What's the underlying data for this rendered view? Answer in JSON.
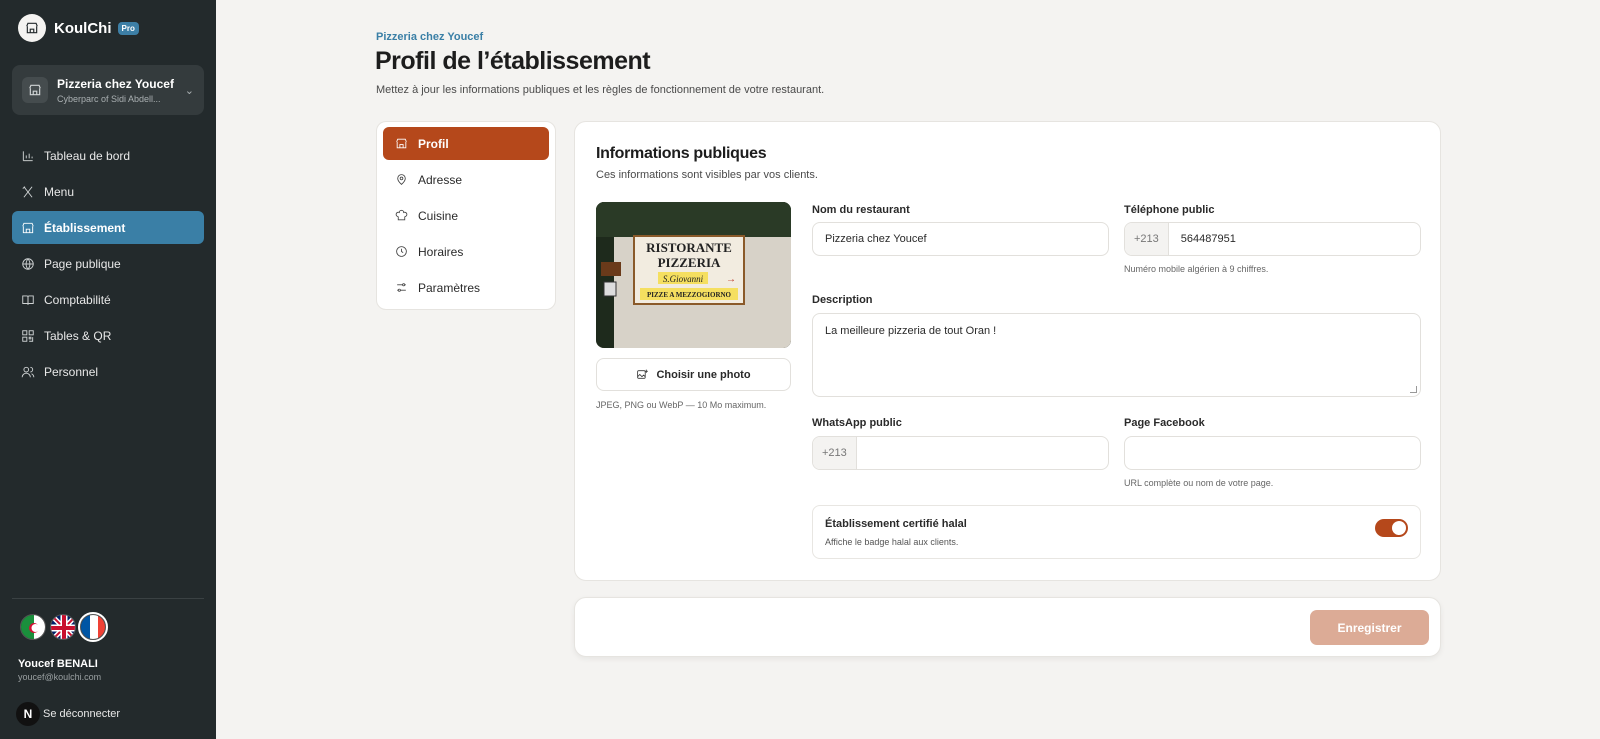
{
  "brand": {
    "name": "KoulChi",
    "badge": "Pro"
  },
  "establishment": {
    "name": "Pizzeria chez Youcef",
    "location": "Cyberparc of Sidi Abdell..."
  },
  "nav": [
    {
      "label": "Tableau de bord",
      "icon": "chart-icon"
    },
    {
      "label": "Menu",
      "icon": "utensils-icon"
    },
    {
      "label": "Établissement",
      "icon": "store-icon",
      "active": true
    },
    {
      "label": "Page publique",
      "icon": "globe-icon"
    },
    {
      "label": "Comptabilité",
      "icon": "book-icon"
    },
    {
      "label": "Tables & QR",
      "icon": "qr-icon"
    },
    {
      "label": "Personnel",
      "icon": "users-icon"
    }
  ],
  "languages": [
    "algeria-flag",
    "uk-flag",
    "france-flag"
  ],
  "user": {
    "name": "Youcef BENALI",
    "email": "youcef@koulchi.com",
    "logout_label": "Se déconnecter",
    "avatar_letter": "N"
  },
  "header": {
    "eyebrow": "Pizzeria chez Youcef",
    "title": "Profil de l’établissement",
    "subtitle": "Mettez à jour les informations publiques et les règles de fonctionnement de votre restaurant."
  },
  "subnav": [
    {
      "label": "Profil",
      "icon": "store-icon",
      "active": true
    },
    {
      "label": "Adresse",
      "icon": "pin-icon"
    },
    {
      "label": "Cuisine",
      "icon": "chef-hat-icon"
    },
    {
      "label": "Horaires",
      "icon": "clock-icon"
    },
    {
      "label": "Paramètres",
      "icon": "sliders-icon"
    }
  ],
  "form": {
    "title": "Informations publiques",
    "subtitle": "Ces informations sont visibles par vos clients.",
    "photo_button": "Choisir une photo",
    "photo_hint": "JPEG, PNG ou WebP — 10 Mo maximum.",
    "photo_sign": {
      "line1": "RISTORANTE",
      "line2": "PIZZERIA",
      "line3": "S.Giovanni",
      "line4": "PIZZE A MEZZOGIORNO"
    },
    "name_label": "Nom du restaurant",
    "name_value": "Pizzeria chez Youcef",
    "phone_label": "Téléphone public",
    "phone_prefix": "+213",
    "phone_value": "564487951",
    "phone_hint": "Numéro mobile algérien à 9 chiffres.",
    "description_label": "Description",
    "description_value": "La meilleure pizzeria de tout Oran !",
    "whatsapp_label": "WhatsApp public",
    "whatsapp_prefix": "+213",
    "whatsapp_value": "",
    "facebook_label": "Page Facebook",
    "facebook_value": "",
    "facebook_hint": "URL complète ou nom de votre page.",
    "halal_title": "Établissement certifié halal",
    "halal_sub": "Affiche le badge halal aux clients.",
    "halal_enabled": true
  },
  "save_label": "Enregistrer",
  "colors": {
    "accent": "#b5481b",
    "sidebar_active": "#3a7fa6",
    "sidebar_bg": "#232a2c",
    "save_disabled": "#dcab96"
  }
}
